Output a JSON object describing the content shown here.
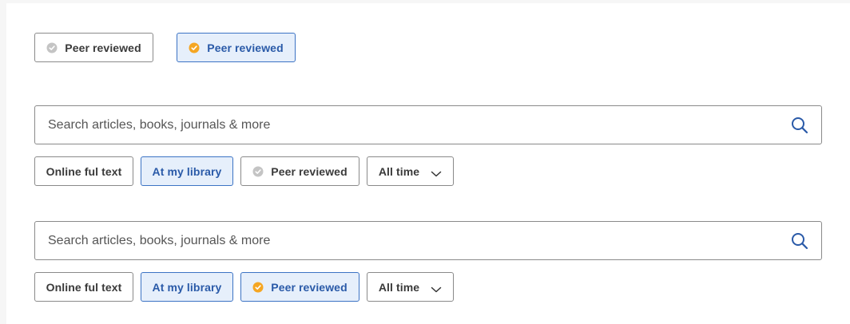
{
  "badges_demo": {
    "inactive_label": "Peer reviewed",
    "active_label": "Peer reviewed"
  },
  "search_a": {
    "placeholder": "Search articles, books, journals & more",
    "filters": {
      "online": "Online ful text",
      "library": "At my library",
      "peer": "Peer reviewed",
      "time": "All time"
    },
    "peer_reviewed_selected": false
  },
  "search_b": {
    "placeholder": "Search articles, books, journals & more",
    "filters": {
      "online": "Online ful text",
      "library": "At my library",
      "peer": "Peer reviewed",
      "time": "All time"
    },
    "peer_reviewed_selected": true
  },
  "colors": {
    "accent_blue": "#2a5aa8",
    "active_bg": "#e6effb",
    "badge_gold": "#f5a623",
    "badge_gray": "#c4c4c4"
  },
  "icons": {
    "badge": "verified-badge-icon",
    "search": "search-icon",
    "dropdown": "chevron-down-icon"
  }
}
